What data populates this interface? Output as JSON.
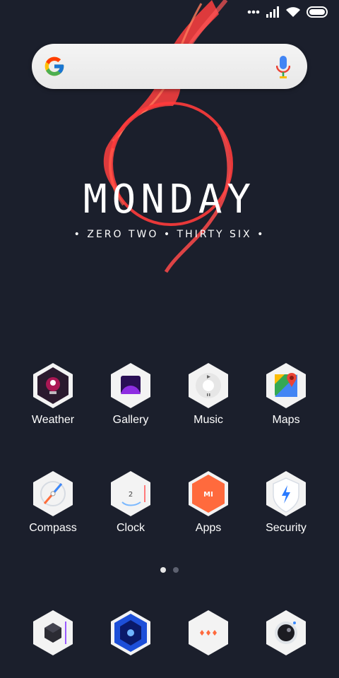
{
  "status_bar": {
    "icons": [
      "more-dots-icon",
      "signal-icon",
      "wifi-icon",
      "battery-icon"
    ]
  },
  "search": {
    "logo": "google-g-icon",
    "mic": "microphone-icon"
  },
  "widget": {
    "day": "MONDAY",
    "time_words": "• ZERO TWO • THIRTY SIX •"
  },
  "apps_row1": [
    {
      "label": "Weather"
    },
    {
      "label": "Gallery"
    },
    {
      "label": "Music"
    },
    {
      "label": "Maps"
    }
  ],
  "apps_row2": [
    {
      "label": "Compass"
    },
    {
      "label": "Clock"
    },
    {
      "label": "Apps"
    },
    {
      "label": "Security"
    }
  ],
  "pager": {
    "pages": 2,
    "active_page": 1
  },
  "dock": {
    "icons": [
      "cube-app-icon",
      "blue-portal-app-icon",
      "messaging-dots-app-icon",
      "camera-app-icon"
    ]
  },
  "colors": {
    "background": "#1b1f2c",
    "accent_red": "#ff3b3b"
  }
}
